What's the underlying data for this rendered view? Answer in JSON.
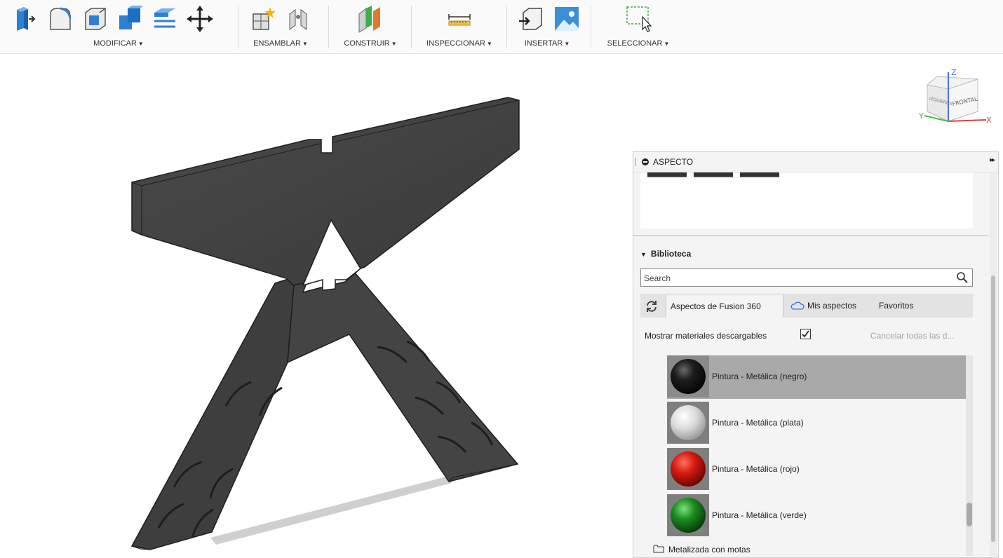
{
  "toolbar": {
    "groups": [
      {
        "label": "MODIFICAR",
        "icons": [
          "press-pull-icon",
          "fillet-icon",
          "shell-icon",
          "combine-icon",
          "offset-face-icon",
          "move-icon"
        ]
      },
      {
        "label": "ENSAMBLAR",
        "icons": [
          "new-component-icon",
          "joint-icon"
        ]
      },
      {
        "label": "CONSTRUIR",
        "icons": [
          "construct-plane-icon"
        ]
      },
      {
        "label": "INSPECCIONAR",
        "icons": [
          "measure-icon"
        ]
      },
      {
        "label": "INSERTAR",
        "icons": [
          "insert-derive-icon",
          "insert-image-icon"
        ]
      },
      {
        "label": "SELECCIONAR",
        "icons": [
          "window-select-icon"
        ]
      }
    ],
    "caret": "▼"
  },
  "viewcube": {
    "face_front": "FRONTAL",
    "face_left": "IZQUIERDA",
    "axis_x": "X",
    "axis_y": "Y",
    "axis_z": "Z"
  },
  "panel": {
    "title": "ASPECTO",
    "expand_glyph": "▸▸",
    "library_toggle": "Biblioteca",
    "library_arrow": "▼",
    "search_placeholder": "Search",
    "tabs": {
      "fusion": "Aspectos de Fusion 360",
      "mine": "Mis aspectos",
      "favorites": "Favoritos"
    },
    "show_downloadable": "Mostrar materiales descargables",
    "show_downloadable_checked": true,
    "cancel_all": "Cancelar todas las d...",
    "materials": [
      {
        "label": "Pintura - Metálica (negro)",
        "color": "#1a1a1a",
        "selected": true
      },
      {
        "label": "Pintura - Metálica (plata)",
        "color": "#e6e6e6",
        "selected": false
      },
      {
        "label": "Pintura - Metálica (rojo)",
        "color": "#d41a0e",
        "selected": false
      },
      {
        "label": "Pintura - Metálica (verde)",
        "color": "#1a8a1e",
        "selected": false
      }
    ],
    "folder": "Metalizada con motas"
  }
}
